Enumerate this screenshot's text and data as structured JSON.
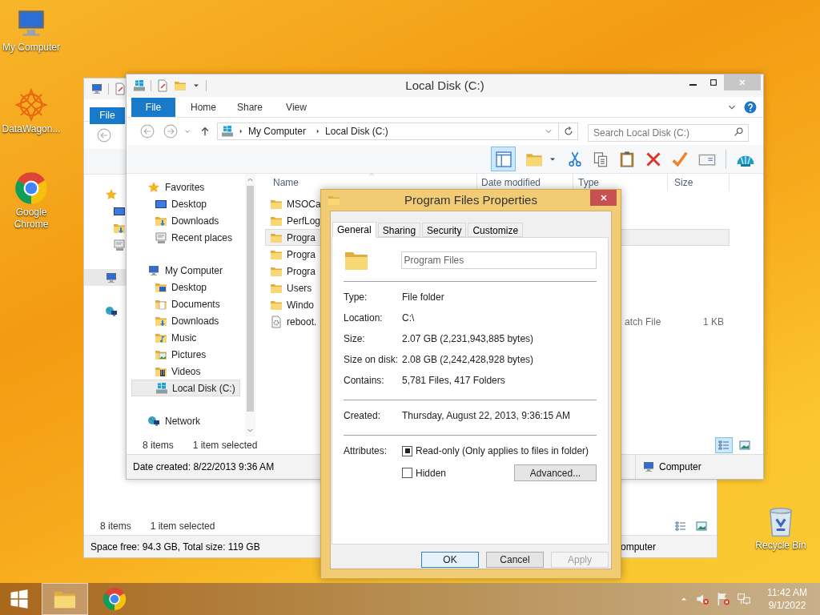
{
  "desktop_icons": [
    {
      "label": "My Computer",
      "kind": "computer"
    },
    {
      "label": "DataWagon...",
      "kind": "app"
    },
    {
      "label": "Google Chrome",
      "kind": "chrome"
    },
    {
      "label": "Recycle Bin",
      "kind": "bin"
    }
  ],
  "back_window": {
    "file_tab": "File",
    "nav_items": [
      {
        "kind": "star",
        "selected": false
      },
      {
        "kind": "computer",
        "selected": true
      },
      {
        "kind": "network",
        "selected": false
      }
    ],
    "status": {
      "items": "8 items",
      "selection": "1 item selected"
    },
    "views": [
      {
        "kind": "details",
        "selected": false
      },
      {
        "kind": "thumbnails",
        "selected": false
      }
    ],
    "details": "Space free: 94.3 GB, Total size: 119 GB",
    "location": "omputer"
  },
  "explorer": {
    "title": "Local Disk (C:)",
    "ribbon_tabs": [
      {
        "label": "File",
        "kind": "file"
      },
      {
        "label": "Home",
        "kind": "tab"
      },
      {
        "label": "Share",
        "kind": "tab"
      },
      {
        "label": "View",
        "kind": "tab"
      }
    ],
    "address": {
      "crumbs": [
        "My Computer",
        "Local Disk (C:)"
      ]
    },
    "search": {
      "placeholder": "Search Local Disk (C:)"
    },
    "toolbar": {
      "preview_pane_selected": true
    },
    "columns": [
      "Name",
      "Date modified",
      "Type",
      "Size"
    ],
    "nav": [
      {
        "label": "Favorites",
        "kind": "star",
        "selected": false,
        "children": [
          {
            "label": "Desktop",
            "kind": "desktop",
            "selected": false
          },
          {
            "label": "Downloads",
            "kind": "download",
            "selected": false
          },
          {
            "label": "Recent places",
            "kind": "recent",
            "selected": false
          }
        ]
      },
      {
        "label": "My Computer",
        "kind": "computer",
        "selected": false,
        "children": [
          {
            "label": "Desktop",
            "kind": "desktopfolder",
            "selected": false
          },
          {
            "label": "Documents",
            "kind": "documents",
            "selected": false
          },
          {
            "label": "Downloads",
            "kind": "download",
            "selected": false
          },
          {
            "label": "Music",
            "kind": "music",
            "selected": false
          },
          {
            "label": "Pictures",
            "kind": "pictures",
            "selected": false
          },
          {
            "label": "Videos",
            "kind": "videos",
            "selected": false
          },
          {
            "label": "Local Disk (C:)",
            "kind": "drive",
            "selected": true
          }
        ]
      },
      {
        "label": "Network",
        "kind": "network",
        "selected": false
      }
    ],
    "files": [
      {
        "name": "MSOCa",
        "kind": "folder",
        "selected": false
      },
      {
        "name": "PerfLog",
        "kind": "folder",
        "selected": false
      },
      {
        "name": "Progra",
        "kind": "folder",
        "selected": true
      },
      {
        "name": "Progra",
        "kind": "folder",
        "selected": false
      },
      {
        "name": "Progra",
        "kind": "folder",
        "selected": false
      },
      {
        "name": "Users",
        "kind": "folder",
        "selected": false
      },
      {
        "name": "Windo",
        "kind": "folder",
        "selected": false
      },
      {
        "name": "reboot.",
        "kind": "batch",
        "selected": false,
        "type": "atch File",
        "size": "1 KB"
      }
    ],
    "status": {
      "items": "8 items",
      "selection": "1 item selected"
    },
    "views": [
      {
        "kind": "details",
        "selected": true
      },
      {
        "kind": "thumbnails",
        "selected": false
      }
    ],
    "details": "Date created: 8/22/2013 9:36 AM",
    "location": "Computer"
  },
  "dialog": {
    "title": "Program Files Properties",
    "tabs": [
      {
        "label": "General",
        "selected": true
      },
      {
        "label": "Sharing",
        "selected": false
      },
      {
        "label": "Security",
        "selected": false
      },
      {
        "label": "Customize",
        "selected": false
      }
    ],
    "name": "Program Files",
    "groups": [
      [
        {
          "label": "Type:",
          "value": "File folder"
        },
        {
          "label": "Location:",
          "value": "C:\\"
        },
        {
          "label": "Size:",
          "value": "2.07 GB (2,231,943,885 bytes)"
        },
        {
          "label": "Size on disk:",
          "value": "2.08 GB (2,242,428,928 bytes)"
        },
        {
          "label": "Contains:",
          "value": "5,781 Files, 417 Folders"
        }
      ],
      [
        {
          "label": "Created:",
          "value": "Thursday, August 22, 2013, 9:36:15 AM"
        }
      ]
    ],
    "attributes": {
      "label": "Attributes:",
      "options": [
        {
          "label": "Read-only (Only applies to files in folder)",
          "indeterminate": true
        },
        {
          "label": "Hidden",
          "checked": false,
          "indeterminate": false
        }
      ],
      "advanced": "Advanced..."
    },
    "buttons": [
      {
        "label": "OK",
        "default": true,
        "disabled": false
      },
      {
        "label": "Cancel",
        "default": false,
        "disabled": false
      },
      {
        "label": "Apply",
        "default": false,
        "disabled": true
      }
    ]
  },
  "taskbar": {
    "apps": [
      {
        "kind": "explorer",
        "selected": true
      },
      {
        "kind": "chrome",
        "selected": false
      }
    ],
    "time": "11:42 AM",
    "date": "9/1/2022"
  }
}
